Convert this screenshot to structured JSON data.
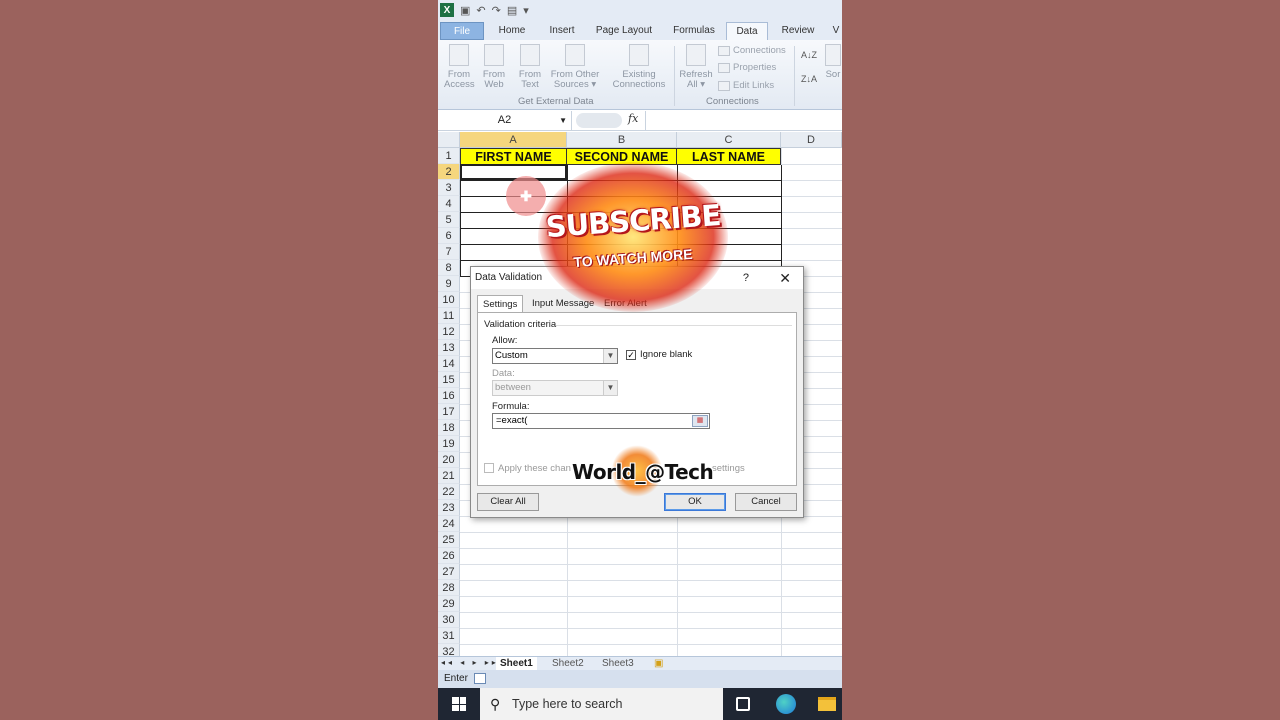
{
  "qat": {
    "undo": "↶",
    "redo": "↷"
  },
  "tabs": [
    "File",
    "Home",
    "Insert",
    "Page Layout",
    "Formulas",
    "Data",
    "Review",
    "V"
  ],
  "active_tab": "Data",
  "ribbon": {
    "buttons": [
      {
        "l1": "From",
        "l2": "Access"
      },
      {
        "l1": "From",
        "l2": "Web"
      },
      {
        "l1": "From",
        "l2": "Text"
      },
      {
        "l1": "From Other",
        "l2": "Sources ▾"
      },
      {
        "l1": "Existing",
        "l2": "Connections"
      },
      {
        "l1": "Refresh",
        "l2": "All ▾"
      }
    ],
    "group_external": "Get External Data",
    "group_connections": "Connections",
    "connections": "Connections",
    "properties": "Properties",
    "edit_links": "Edit Links",
    "sort_az": "A↓Z",
    "sort_za": "Z↓A",
    "sort_label": "Sor"
  },
  "formula_bar": {
    "name_box": "A2",
    "fx": "fx",
    "value": ""
  },
  "grid": {
    "columns": [
      "A",
      "B",
      "C",
      "D"
    ],
    "header_cells": [
      "FIRST NAME",
      "SECOND NAME",
      "LAST NAME"
    ],
    "rows": [
      "1",
      "2",
      "3",
      "4",
      "5",
      "6",
      "7",
      "8",
      "9",
      "10",
      "11",
      "12",
      "13",
      "14",
      "15",
      "16",
      "17",
      "18",
      "19",
      "20",
      "21",
      "22",
      "23",
      "24",
      "25",
      "26",
      "27",
      "28",
      "29",
      "30",
      "31",
      "32"
    ]
  },
  "sheets": {
    "nav": "◂◂ ◂ ▸ ▸▸",
    "tabs": [
      "Sheet1",
      "Sheet2",
      "Sheet3"
    ],
    "active": "Sheet1"
  },
  "status": "Enter",
  "taskbar": {
    "search_placeholder": "Type here to search"
  },
  "dialog": {
    "title": "Data Validation",
    "help": "?",
    "close": "✕",
    "tabs": [
      "Settings",
      "Input Message",
      "Error Alert"
    ],
    "criteria_label": "Validation criteria",
    "allow_label": "Allow:",
    "allow_value": "Custom",
    "ignore_blank": "Ignore blank",
    "data_label": "Data:",
    "data_value": "between",
    "formula_label": "Formula:",
    "formula_value": "=exact(",
    "apply_text": "Apply these changes to all other cells with the same settings",
    "apply_visible_left": "Apply these chan",
    "apply_visible_right": "settings",
    "clear_all": "Clear All",
    "ok": "OK",
    "cancel": "Cancel"
  },
  "overlay": {
    "subscribe": "SUBSCRIBE",
    "subscribe_sub": "TO WATCH MORE",
    "watermark": "World_@Tech"
  }
}
